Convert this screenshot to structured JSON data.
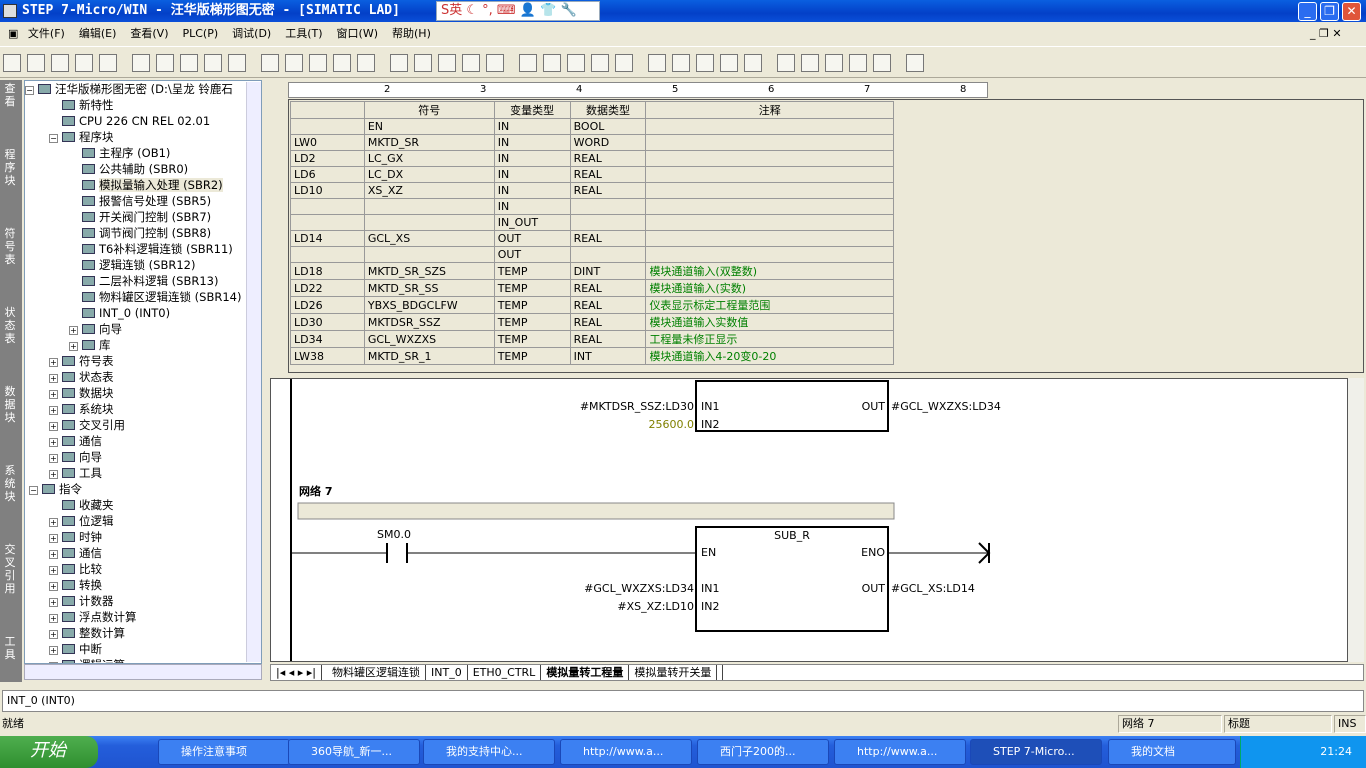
{
  "window": {
    "title": "STEP 7-Micro/WIN - 汪华版梯形图无密 - [SIMATIC LAD]",
    "ime": "S英 ☾ °, ⌨ 👤 👕 🔧"
  },
  "menu": [
    "文件(F)",
    "编辑(E)",
    "查看(V)",
    "PLC(P)",
    "调试(D)",
    "工具(T)",
    "窗口(W)",
    "帮助(H)"
  ],
  "nav_bar": [
    "查看",
    "程序块",
    "符号表",
    "状态表",
    "数据块",
    "系统块",
    "交叉引用",
    "工具"
  ],
  "tree": {
    "root": "汪华版梯形图无密 (D:\\呈龙 铃鹿石",
    "items": [
      {
        "label": "新特性",
        "level": 1
      },
      {
        "label": "CPU 226 CN REL 02.01",
        "level": 1
      },
      {
        "label": "程序块",
        "level": 1,
        "exp": "−"
      },
      {
        "label": "主程序 (OB1)",
        "level": 2
      },
      {
        "label": "公共辅助 (SBR0)",
        "level": 2
      },
      {
        "label": "模拟量输入处理 (SBR2)",
        "level": 2,
        "selected": true
      },
      {
        "label": "报警信号处理 (SBR5)",
        "level": 2
      },
      {
        "label": "开关阀门控制 (SBR7)",
        "level": 2
      },
      {
        "label": "调节阀门控制 (SBR8)",
        "level": 2
      },
      {
        "label": "T6补料逻辑连锁 (SBR11)",
        "level": 2
      },
      {
        "label": "逻辑连锁 (SBR12)",
        "level": 2
      },
      {
        "label": "二层补料逻辑 (SBR13)",
        "level": 2
      },
      {
        "label": "物料罐区逻辑连锁 (SBR14)",
        "level": 2
      },
      {
        "label": "INT_0 (INT0)",
        "level": 2
      },
      {
        "label": "向导",
        "level": 2,
        "exp": "+"
      },
      {
        "label": "库",
        "level": 2,
        "exp": "+"
      },
      {
        "label": "符号表",
        "level": 1,
        "exp": "+"
      },
      {
        "label": "状态表",
        "level": 1,
        "exp": "+"
      },
      {
        "label": "数据块",
        "level": 1,
        "exp": "+"
      },
      {
        "label": "系统块",
        "level": 1,
        "exp": "+"
      },
      {
        "label": "交叉引用",
        "level": 1,
        "exp": "+"
      },
      {
        "label": "通信",
        "level": 1,
        "exp": "+"
      },
      {
        "label": "向导",
        "level": 1,
        "exp": "+"
      },
      {
        "label": "工具",
        "level": 1,
        "exp": "+"
      },
      {
        "label": "指令",
        "level": 0,
        "exp": "−"
      },
      {
        "label": "收藏夹",
        "level": 1
      },
      {
        "label": "位逻辑",
        "level": 1,
        "exp": "+"
      },
      {
        "label": "时钟",
        "level": 1,
        "exp": "+"
      },
      {
        "label": "通信",
        "level": 1,
        "exp": "+"
      },
      {
        "label": "比较",
        "level": 1,
        "exp": "+"
      },
      {
        "label": "转换",
        "level": 1,
        "exp": "+"
      },
      {
        "label": "计数器",
        "level": 1,
        "exp": "+"
      },
      {
        "label": "浮点数计算",
        "level": 1,
        "exp": "+"
      },
      {
        "label": "整数计算",
        "level": 1,
        "exp": "+"
      },
      {
        "label": "中断",
        "level": 1,
        "exp": "+"
      },
      {
        "label": "逻辑运算",
        "level": 1,
        "exp": "+"
      }
    ]
  },
  "ruler": [
    "2",
    "3",
    "4",
    "5",
    "6",
    "7",
    "8"
  ],
  "var_table": {
    "headers": [
      "",
      "符号",
      "变量类型",
      "数据类型",
      "注释"
    ],
    "rows": [
      [
        "",
        "EN",
        "IN",
        "BOOL",
        ""
      ],
      [
        "LW0",
        "MKTD_SR",
        "IN",
        "WORD",
        ""
      ],
      [
        "LD2",
        "LC_GX",
        "IN",
        "REAL",
        ""
      ],
      [
        "LD6",
        "LC_DX",
        "IN",
        "REAL",
        ""
      ],
      [
        "LD10",
        "XS_XZ",
        "IN",
        "REAL",
        ""
      ],
      [
        "",
        "",
        "IN",
        "",
        ""
      ],
      [
        "",
        "",
        "IN_OUT",
        "",
        ""
      ],
      [
        "LD14",
        "GCL_XS",
        "OUT",
        "REAL",
        ""
      ],
      [
        "",
        "",
        "OUT",
        "",
        ""
      ],
      [
        "LD18",
        "MKTD_SR_SZS",
        "TEMP",
        "DINT",
        "模块通道输入(双整数)"
      ],
      [
        "LD22",
        "MKTD_SR_SS",
        "TEMP",
        "REAL",
        "模块通道输入(实数)"
      ],
      [
        "LD26",
        "YBXS_BDGCLFW",
        "TEMP",
        "REAL",
        "仪表显示标定工程量范围"
      ],
      [
        "LD30",
        "MKTDSR_SSZ",
        "TEMP",
        "REAL",
        "模块通道输入实数值"
      ],
      [
        "LD34",
        "GCL_WXZXS",
        "TEMP",
        "REAL",
        "工程量未修正显示"
      ],
      [
        "LW38",
        "MKTD_SR_1",
        "TEMP",
        "INT",
        "模块通道输入4-20变0-20"
      ]
    ]
  },
  "ladder": {
    "prev": {
      "in1": "#MKTDSR_SSZ:LD30",
      "in1_pin": "IN1",
      "in2": "25600.0",
      "in2_pin": "IN2",
      "out_pin": "OUT",
      "out": "#GCL_WXZXS:LD34"
    },
    "network": "网络 7",
    "block": {
      "name": "SUB_R",
      "en": "EN",
      "eno": "ENO",
      "contact": "SM0.0",
      "in1": "#GCL_WXZXS:LD34",
      "in1_pin": "IN1",
      "in2": "#XS_XZ:LD10",
      "in2_pin": "IN2",
      "out_pin": "OUT",
      "out": "#GCL_XS:LD14"
    },
    "constant_color": "#808000"
  },
  "tabs": [
    "物料罐区逻辑连锁",
    "INT_0",
    "ETH0_CTRL",
    "模拟量转工程量",
    "模拟量转开关量"
  ],
  "active_tab": "模拟量转工程量",
  "output": "INT_0 (INT0)",
  "status": {
    "left": "就绪",
    "network": "网络 7",
    "title": "标题",
    "mode": "INS"
  },
  "taskbar": {
    "start": "开始",
    "items": [
      "操作注意事项",
      "360导航_新一...",
      "我的支持中心...",
      "http://www.a...",
      "西门子200的...",
      "http://www.a...",
      "STEP 7-Micro...",
      "我的文档"
    ],
    "active": "STEP 7-Micro...",
    "clock": "21:24"
  }
}
